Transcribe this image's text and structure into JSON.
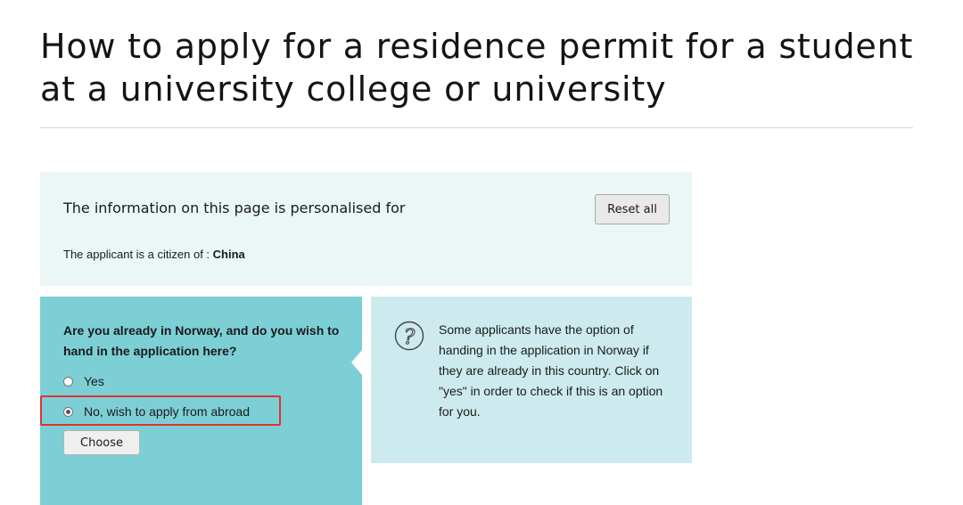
{
  "page": {
    "title": "How to apply for a residence permit for a student at a university college or university"
  },
  "personalisation": {
    "heading": "The information on this page is personalised for",
    "reset_label": "Reset all",
    "citizen_label": "The applicant is a citizen of : ",
    "citizen_value": "China"
  },
  "question": {
    "text": "Are you already in Norway, and do you wish to hand in the application here?",
    "options": [
      {
        "label": "Yes",
        "selected": false
      },
      {
        "label": "No, wish to apply from abroad",
        "selected": true
      }
    ],
    "choose_label": "Choose"
  },
  "help": {
    "icon": "question-mark-icon",
    "text": "Some applicants have the option of handing in the application in Norway if they are already in this country. Click on \"yes\" in order to check if this is an option for you."
  },
  "colors": {
    "info_box_bg": "#ebf6f7",
    "question_box_bg": "#7dcfd6",
    "help_box_bg": "#cdebee",
    "highlight": "#e0322f"
  }
}
